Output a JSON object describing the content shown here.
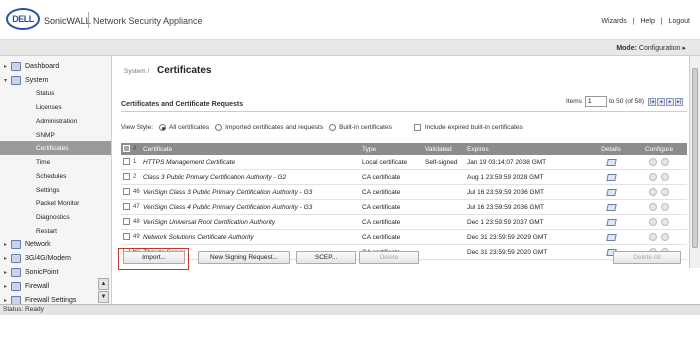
{
  "header": {
    "logo_text": "DELL",
    "brand": "SonicWALL",
    "product": "Network Security Appliance",
    "links": [
      "Wizards",
      "Help",
      "Logout"
    ],
    "link_sep": "|"
  },
  "modebar": {
    "mode_label": "Mode:",
    "mode_value": "Configuration ▸"
  },
  "sidebar": {
    "items": [
      {
        "label": "Dashboard",
        "arrow": "▸",
        "icon": "dashboard-icon"
      },
      {
        "label": "System",
        "arrow": "▾",
        "icon": "system-icon"
      }
    ],
    "system_sub": [
      "Status",
      "Licenses",
      "Administration",
      "SNMP",
      "Certificates",
      "Time",
      "Schedules",
      "Settings",
      "Packet Monitor",
      "Diagnostics",
      "Restart"
    ],
    "active_sub": "Certificates",
    "bottom_items": [
      {
        "label": "Network",
        "arrow": "▸",
        "icon": "network-icon"
      },
      {
        "label": "3G/4G/Modem",
        "arrow": "▸",
        "icon": "modem-icon"
      },
      {
        "label": "SonicPoint",
        "arrow": "▸",
        "icon": "sonicpoint-icon"
      },
      {
        "label": "Firewall",
        "arrow": "▸",
        "icon": "firewall-icon"
      },
      {
        "label": "Firewall Settings",
        "arrow": "▸",
        "icon": "firewall-settings-icon"
      }
    ],
    "scroll_up": "▲",
    "scroll_down": "▼"
  },
  "main": {
    "breadcrumb": "System /",
    "title": "Certificates",
    "section_title": "Certificates and Certificate Requests",
    "pager": {
      "items_label": "Items",
      "items_value": "1",
      "range_text": "to 50 (of 58)",
      "buttons": [
        "|◂",
        "◂",
        "▸",
        "▸|"
      ]
    },
    "view_style": {
      "label": "View Style:",
      "options": [
        "All certificates",
        "Imported certificates and requests",
        "Built-in certificates"
      ],
      "selected": "All certificates",
      "include_expired": "Include expired built-in certificates"
    },
    "table": {
      "columns": [
        "#",
        "Certificate",
        "Type",
        "Validated",
        "Expires",
        "Details",
        "Configure"
      ],
      "rows": [
        {
          "idx": "1",
          "name": "HTTPS Management Certificate",
          "type": "Local certificate",
          "validated": "Self-signed",
          "expires": "Jan 19 03:14:07 2038 GMT"
        },
        {
          "idx": "2",
          "name": "Class 3 Public Primary Certification Authority - G2",
          "type": "CA certificate",
          "validated": "",
          "expires": "Aug 1 23:59:59 2028 GMT"
        },
        {
          "idx": "46",
          "name": "VeriSign Class 3 Public Primary Certification Authority - G3",
          "type": "CA certificate",
          "validated": "",
          "expires": "Jul 16 23:59:59 2036 GMT"
        },
        {
          "idx": "47",
          "name": "VeriSign Class 4 Public Primary Certification Authority - G3",
          "type": "CA certificate",
          "validated": "",
          "expires": "Jul 16 23:59:59 2036 GMT"
        },
        {
          "idx": "48",
          "name": "VeriSign Universal Root Certification Authority",
          "type": "CA certificate",
          "validated": "",
          "expires": "Dec 1 23:59:59 2037 GMT"
        },
        {
          "idx": "49",
          "name": "Network Solutions Certificate Authority",
          "type": "CA certificate",
          "validated": "",
          "expires": "Dec 31 23:59:59 2029 GMT"
        },
        {
          "idx": "50",
          "name": "Thawte Server",
          "type": "CA certificate",
          "validated": "",
          "expires": "Dec 31 23:59:59 2020 GMT"
        }
      ]
    },
    "buttons": {
      "import": "Import...",
      "new_signing": "New Signing Request...",
      "scep": "SCEP...",
      "delete": "Delete",
      "delete_all": "Delete All"
    }
  },
  "status": "Status: Ready"
}
